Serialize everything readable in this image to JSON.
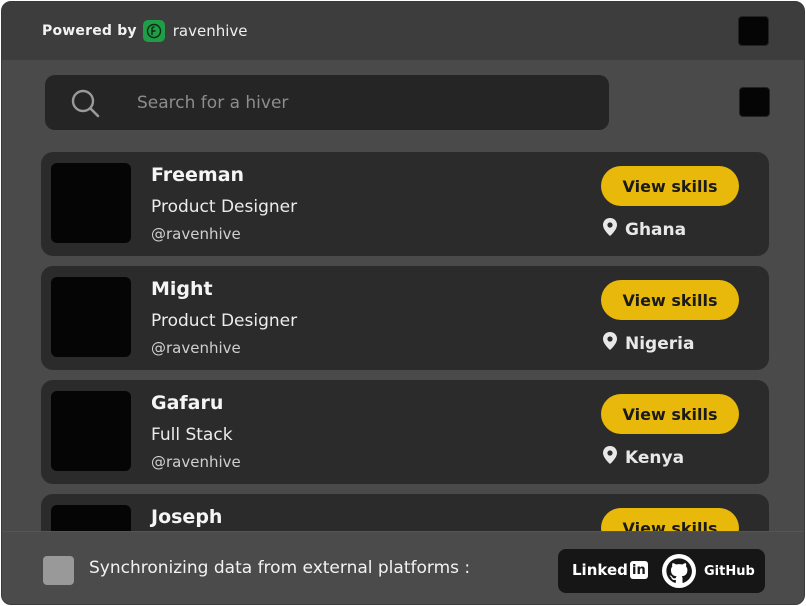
{
  "header": {
    "powered_by": "Powered by",
    "brand": "ravenhive"
  },
  "search": {
    "placeholder": "Search for a hiver"
  },
  "profiles": [
    {
      "name": "Freeman",
      "role": "Product Designer",
      "handle": "@ravenhive",
      "button": "View skills",
      "location": "Ghana"
    },
    {
      "name": "Might",
      "role": "Product Designer",
      "handle": "@ravenhive",
      "button": "View skills",
      "location": "Nigeria"
    },
    {
      "name": "Gafaru",
      "role": "Full Stack",
      "handle": "@ravenhive",
      "button": "View skills",
      "location": "Kenya"
    },
    {
      "name": "Joseph",
      "role": "",
      "handle": "",
      "button": "View skills",
      "location": ""
    }
  ],
  "footer": {
    "sync_text": "Synchronizing data from external platforms :",
    "linkedin_label": "Linked",
    "linkedin_in": "in",
    "github_label": "GitHub"
  },
  "colors": {
    "accent": "#e8b90a",
    "brand_green": "#1f9d47"
  },
  "icons": {
    "search": "search-icon",
    "location": "map-pin-icon",
    "logo": "ravenhive-logo-icon",
    "github": "github-icon"
  }
}
